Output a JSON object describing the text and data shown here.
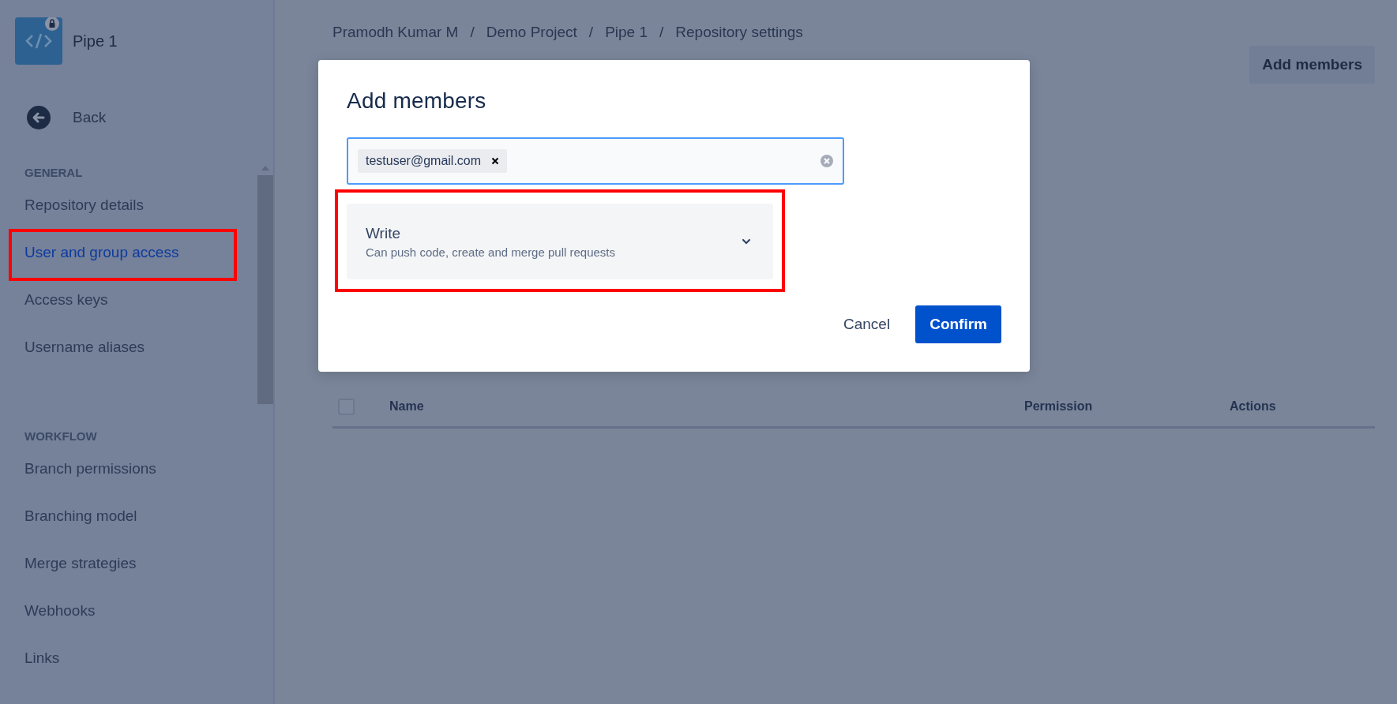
{
  "sidebar": {
    "repo_name": "Pipe 1",
    "back_label": "Back",
    "sections": [
      {
        "heading": "GENERAL",
        "items": [
          {
            "label": "Repository details",
            "selected": false,
            "highlighted": false
          },
          {
            "label": "User and group access",
            "selected": true,
            "highlighted": true
          },
          {
            "label": "Access keys",
            "selected": false,
            "highlighted": false
          },
          {
            "label": "Username aliases",
            "selected": false,
            "highlighted": false
          }
        ]
      },
      {
        "heading": "WORKFLOW",
        "items": [
          {
            "label": "Branch permissions",
            "selected": false,
            "highlighted": false
          },
          {
            "label": "Branching model",
            "selected": false,
            "highlighted": false
          },
          {
            "label": "Merge strategies",
            "selected": false,
            "highlighted": false
          },
          {
            "label": "Webhooks",
            "selected": false,
            "highlighted": false
          },
          {
            "label": "Links",
            "selected": false,
            "highlighted": false
          }
        ]
      }
    ]
  },
  "breadcrumbs": [
    "Pramodh Kumar M",
    "Demo Project",
    "Pipe 1",
    "Repository settings"
  ],
  "breadcrumb_separator": "/",
  "add_members_button": "Add members",
  "table": {
    "checked": false,
    "columns": [
      "Name",
      "Permission",
      "Actions"
    ]
  },
  "modal": {
    "title": "Add members",
    "tags": [
      "testuser@gmail.com"
    ],
    "permission": {
      "label": "Write",
      "description": "Can push code, create and merge pull requests",
      "highlighted": true
    },
    "buttons": [
      {
        "label": "Cancel",
        "kind": "subtle"
      },
      {
        "label": "Confirm",
        "kind": "primary"
      }
    ]
  }
}
